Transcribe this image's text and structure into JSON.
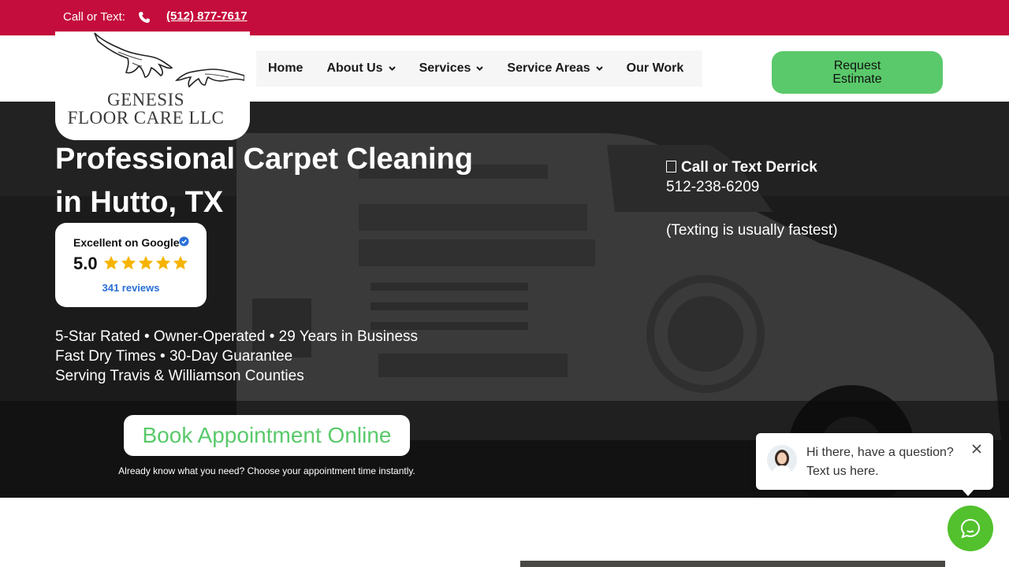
{
  "topbar": {
    "call_label": "Call or Text:",
    "phone": "(512) 877-7617",
    "phone_icon": "phone-icon"
  },
  "logo": {
    "line1": "GENESIS",
    "line2": "FLOOR CARE LLC"
  },
  "nav": {
    "items": [
      {
        "label": "Home",
        "dropdown": false
      },
      {
        "label": "About Us",
        "dropdown": true
      },
      {
        "label": "Services",
        "dropdown": true
      },
      {
        "label": "Service Areas",
        "dropdown": true
      },
      {
        "label": "Our Work",
        "dropdown": false
      }
    ]
  },
  "header": {
    "estimate_label": "Request Estimate"
  },
  "hero": {
    "title": "Professional Carpet Cleaning in Hutto, TX",
    "features": [
      "5-Star Rated • Owner-Operated • 29 Years in Business",
      "Fast Dry Times • 30-Day Guarantee",
      "Serving Travis & Williamson Counties"
    ],
    "book_label": "Book Appointment Online",
    "book_note": "Already know what you need? Choose your appointment time instantly.",
    "call_title": "Call or Text Derrick",
    "call_phone": "512-238-6209",
    "texting_note": "(Texting is usually fastest)"
  },
  "google": {
    "title": "Excellent on Google",
    "score": "5.0",
    "stars": 5,
    "reviews": "341 reviews"
  },
  "chat": {
    "line1": "Hi there, have a question?",
    "line2": "Text us here."
  },
  "colors": {
    "brand_red": "#c40d3c",
    "accent_green": "#5ac96b",
    "chat_green": "#52c12d",
    "star_gold": "#f6b400",
    "link_blue": "#2a6fd6"
  }
}
